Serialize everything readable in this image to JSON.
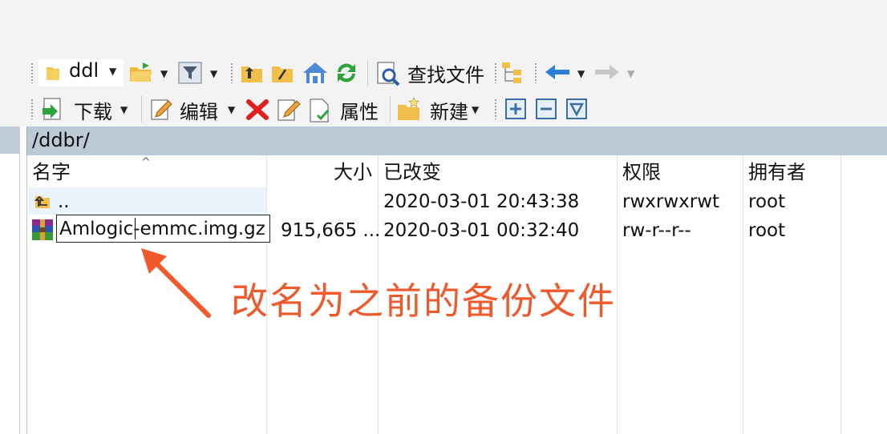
{
  "toolbar_row1": {
    "folder_dropdown": "ddl",
    "find_files_label": "查找文件"
  },
  "toolbar_row2": {
    "download_label": "下载",
    "edit_label": "编辑",
    "properties_label": "属性",
    "new_label": "新建"
  },
  "path": "/ddbr/",
  "columns": {
    "name": "名字",
    "size": "大小",
    "modified": "已改变",
    "permissions": "权限",
    "owner": "拥有者"
  },
  "files": [
    {
      "name": "..",
      "size": "",
      "modified": "2020-03-01 20:43:38",
      "permissions": "rwxrwxrwt",
      "owner": "root"
    },
    {
      "name": "Amlogic-emmc.img.gz",
      "size": "915,665 ...",
      "modified": "2020-03-01 00:32:40",
      "permissions": "rw-r--r--",
      "owner": "root"
    }
  ],
  "annotation": "改名为之前的备份文件",
  "colors": {
    "accent_arrow": "#f0592b",
    "path_bar": "#bccad8"
  }
}
